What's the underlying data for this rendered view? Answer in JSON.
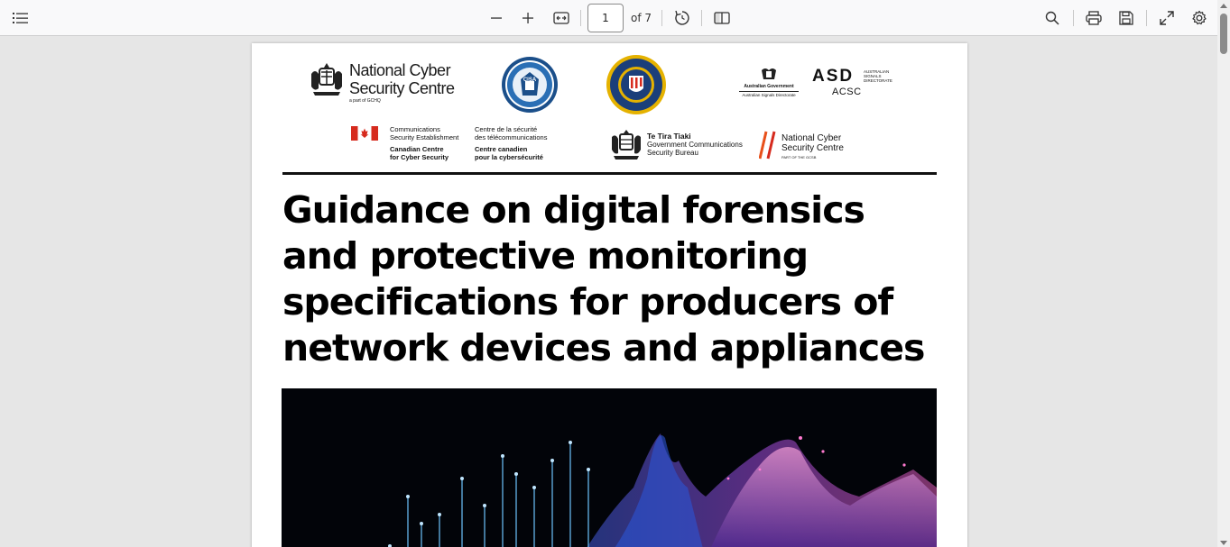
{
  "toolbar": {
    "page_number": "1",
    "page_count": "of 7",
    "icons": {
      "outline": "list-icon",
      "zoom_out": "minus-icon",
      "zoom_in": "plus-icon",
      "fit": "fit-width-icon",
      "rotate": "rotate-icon",
      "view": "two-page-icon",
      "search": "search-icon",
      "print": "print-icon",
      "save": "save-icon",
      "fullscreen": "expand-icon",
      "settings": "gear-icon"
    }
  },
  "document": {
    "logos": {
      "ncsc_uk_line1": "National Cyber",
      "ncsc_uk_line2": "Security Centre",
      "ncsc_uk_sub": "a part of GCHQ",
      "cisa_label": "CISA",
      "aus_gov": "Australian Government",
      "aus_asd_dir": "Australian Signals Directorate",
      "asd": "ASD",
      "asd_side1": "AUSTRALIAN",
      "asd_side2": "SIGNALS",
      "asd_side3": "DIRECTORATE",
      "acsc": "ACSC",
      "cse_en1": "Communications",
      "cse_en2": "Security Establishment",
      "cse_fr1": "Centre de la sécurité",
      "cse_fr2": "des télécommunications",
      "cccs_en1": "Canadian Centre",
      "cccs_en2": "for Cyber Security",
      "cccs_fr1": "Centre canadien",
      "cccs_fr2": "pour la cybersécurité",
      "gcsb_1": "Te Tira Tiaki",
      "gcsb_2": "Government Communications",
      "gcsb_3": "Security Bureau",
      "ncsc_nz_1": "National Cyber",
      "ncsc_nz_2": "Security Centre",
      "ncsc_nz_3": "PART OF THE GCSB"
    },
    "title_lines": [
      "Guidance on digital forensics",
      "and protective monitoring",
      "specifications for producers of",
      "network devices and appliances"
    ]
  },
  "colors": {
    "accent_red": "#d62b1e",
    "navy": "#1b3f7a",
    "gold": "#e5b200"
  }
}
